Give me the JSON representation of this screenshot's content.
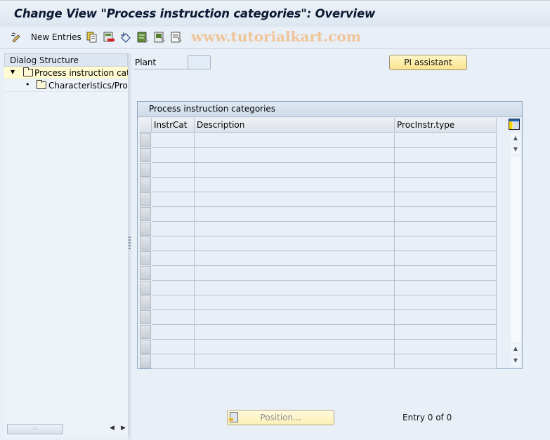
{
  "window": {
    "title": "Change View \"Process instruction categories\": Overview"
  },
  "toolbar": {
    "items": [
      {
        "icon": "display-change-icon",
        "label": ""
      },
      {
        "icon": "new-entries",
        "label": "New Entries"
      },
      {
        "icon": "copy-icon"
      },
      {
        "icon": "delete-icon"
      },
      {
        "icon": "undo-change-icon"
      },
      {
        "icon": "select-all-icon"
      },
      {
        "icon": "select-block-icon"
      },
      {
        "icon": "deselect-all-icon"
      }
    ],
    "new_entries_label": "New Entries"
  },
  "watermark": "www.tutorialkart.com",
  "dialog_structure": {
    "header": "Dialog Structure",
    "items": [
      {
        "label": "Process instruction categ",
        "level": 0,
        "expanded": true,
        "selected": true
      },
      {
        "label": "Characteristics/Proce",
        "level": 1,
        "expanded": false,
        "selected": false
      }
    ]
  },
  "form": {
    "plant_label": "Plant",
    "plant_value": "",
    "pi_assistant_label": "PI assistant"
  },
  "table": {
    "title": "Process instruction categories",
    "columns": [
      "InstrCat",
      "Description",
      "ProcInstr.type"
    ],
    "row_count_visible": 16,
    "rows": []
  },
  "footer": {
    "position_label": "Position...",
    "entry_text": "Entry 0 of 0"
  }
}
